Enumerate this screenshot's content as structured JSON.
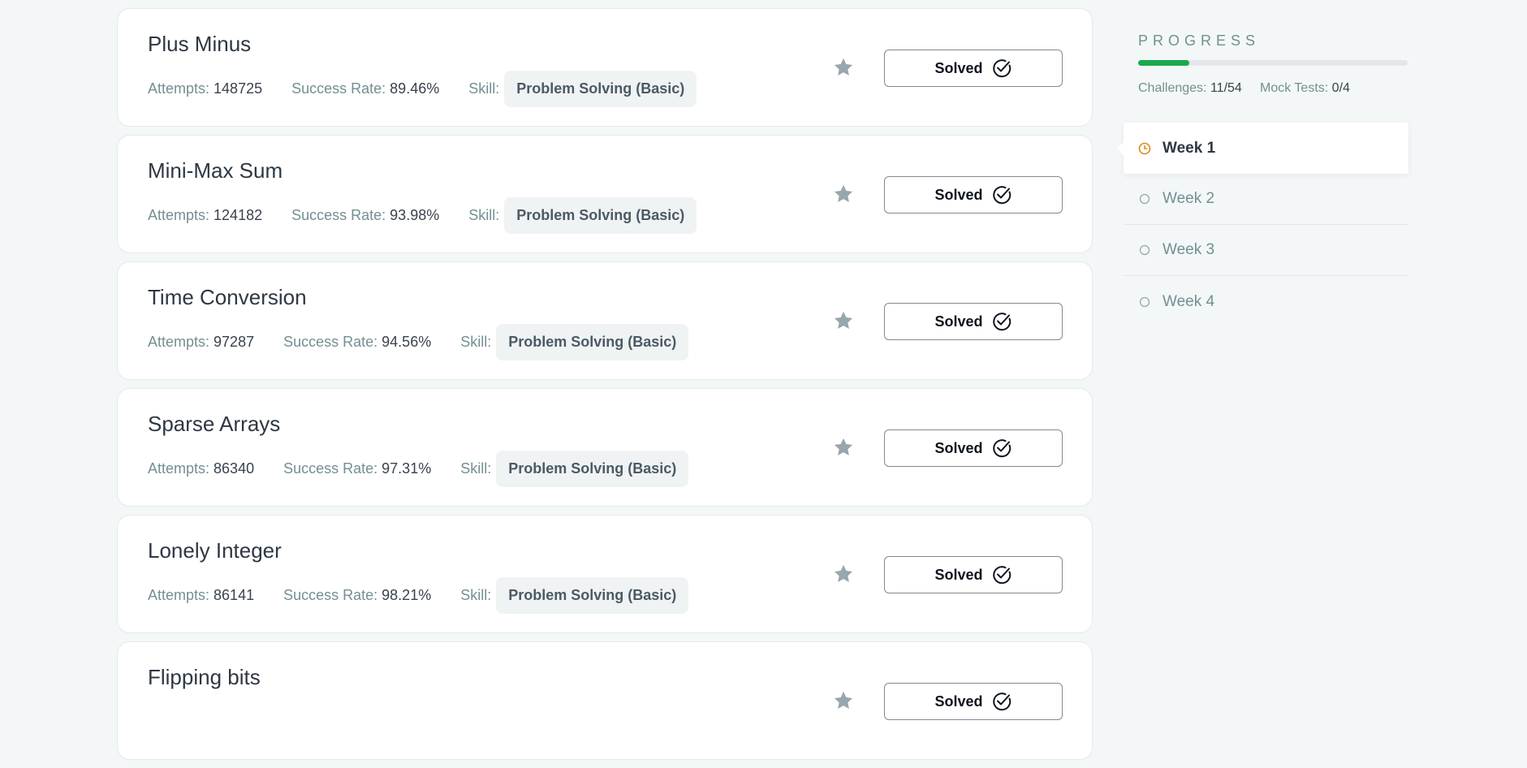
{
  "labels": {
    "attempts": "Attempts:",
    "success_rate": "Success Rate:",
    "skill": "Skill:",
    "solved": "Solved"
  },
  "challenges": [
    {
      "title": "Plus Minus",
      "attempts": "148725",
      "success_rate": "89.46%",
      "skill": "Problem Solving (Basic)",
      "status": "Solved"
    },
    {
      "title": "Mini-Max Sum",
      "attempts": "124182",
      "success_rate": "93.98%",
      "skill": "Problem Solving (Basic)",
      "status": "Solved"
    },
    {
      "title": "Time Conversion",
      "attempts": "97287",
      "success_rate": "94.56%",
      "skill": "Problem Solving (Basic)",
      "status": "Solved"
    },
    {
      "title": "Sparse Arrays",
      "attempts": "86340",
      "success_rate": "97.31%",
      "skill": "Problem Solving (Basic)",
      "status": "Solved"
    },
    {
      "title": "Lonely Integer",
      "attempts": "86141",
      "success_rate": "98.21%",
      "skill": "Problem Solving (Basic)",
      "status": "Solved"
    },
    {
      "title": "Flipping bits",
      "attempts": "",
      "success_rate": "",
      "skill": "",
      "status": "Solved"
    }
  ],
  "sidebar": {
    "progress_title": "PROGRESS",
    "progress_fraction": 0.19,
    "challenges_label": "Challenges:",
    "challenges_value": "11/54",
    "mock_tests_label": "Mock Tests:",
    "mock_tests_value": "0/4",
    "weeks": [
      {
        "label": "Week 1",
        "active": true,
        "icon": "clock-icon"
      },
      {
        "label": "Week 2",
        "active": false,
        "icon": "circle-icon"
      },
      {
        "label": "Week 3",
        "active": false,
        "icon": "circle-icon"
      },
      {
        "label": "Week 4",
        "active": false,
        "icon": "circle-icon"
      }
    ]
  },
  "colors": {
    "accent_green": "#1ba94c",
    "active_clock": "#e18a17",
    "star": "#98a6ad",
    "background": "#f3f7f7"
  }
}
